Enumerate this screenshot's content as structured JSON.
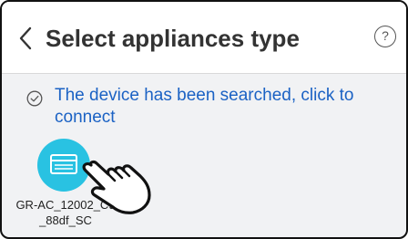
{
  "header": {
    "title": "Select appliances type",
    "help_symbol": "?",
    "back_icon": "chevron-left-icon"
  },
  "status": {
    "icon": "check-circle-icon",
    "text": "The device has been searched, click to connect"
  },
  "devices": [
    {
      "name": "GR-AC_12002_C9_88df_SC",
      "icon": "air-conditioner-icon"
    }
  ],
  "colors": {
    "accent_text": "#1b62c4",
    "device_icon_bg": "#29c2e2",
    "background": "#f1f2f4"
  }
}
